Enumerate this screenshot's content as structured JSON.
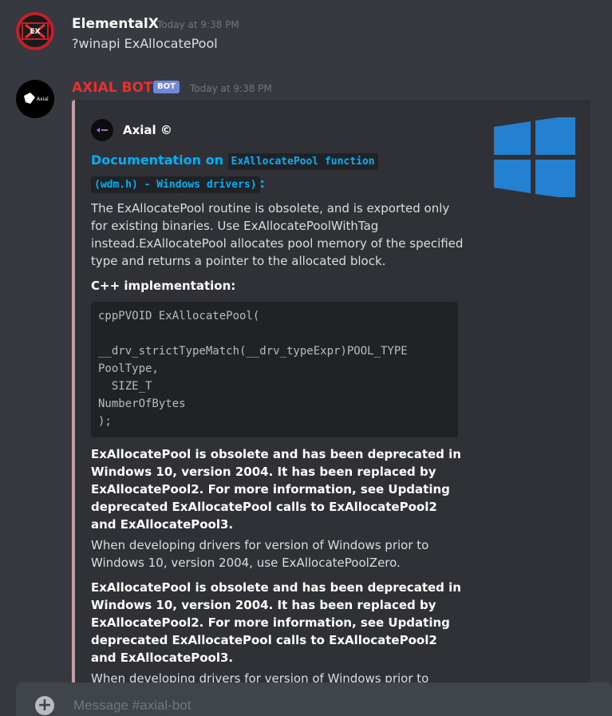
{
  "messages": [
    {
      "username": "ElementalX",
      "username_color": "#ffffff",
      "timestamp": "Today at 9:38 PM",
      "content": "?winapi ExAllocatePool"
    },
    {
      "username": "AXIAL BOT",
      "username_color": "#e8302f",
      "bot_tag": "BOT",
      "timestamp": "Today at 9:38 PM"
    }
  ],
  "embed": {
    "border_color": "#c59aa0",
    "author": "Axial ©",
    "title_prefix": "Documentation on ",
    "title_code_line1": "ExAllocatePool function ",
    "title_code_line2": "(wdm.h) - Windows drivers)",
    "title_suffix": ":",
    "title_color": "#00b0f4",
    "thumbnail_icon": "windows-logo-icon",
    "description": "The ExAllocatePool routine is obsolete, and is exported only for existing binaries. Use ExAllocatePoolWithTag instead.ExAllocatePool allocates pool memory of the specified type and returns a pointer to the allocated block.",
    "implementation_heading": "C++ implementation:",
    "code": "cppPVOID ExAllocatePool(\n\n__drv_strictTypeMatch(__drv_typeExpr)POOL_TYPE\nPoolType,\n  SIZE_T\nNumberOfBytes\n);",
    "notes": [
      {
        "bold": "ExAllocatePool is obsolete and has been deprecated in Windows 10, version 2004. It has been replaced by ExAllocatePool2. For more information, see Updating deprecated ExAllocatePool calls to ExAllocatePool2 and ExAllocatePool3.",
        "normal": "When developing drivers for version of Windows prior to Windows 10, version 2004, use ExAllocatePoolZero."
      },
      {
        "bold": "ExAllocatePool is obsolete and has been deprecated in Windows 10, version 2004. It has been replaced by ExAllocatePool2. For more information, see Updating deprecated ExAllocatePool calls to ExAllocatePool2 and ExAllocatePool3.",
        "normal": "When developing drivers for version of Windows prior to"
      }
    ]
  },
  "composer": {
    "placeholder": "Message #axial-bot",
    "add_icon": "plus-circle-icon"
  }
}
